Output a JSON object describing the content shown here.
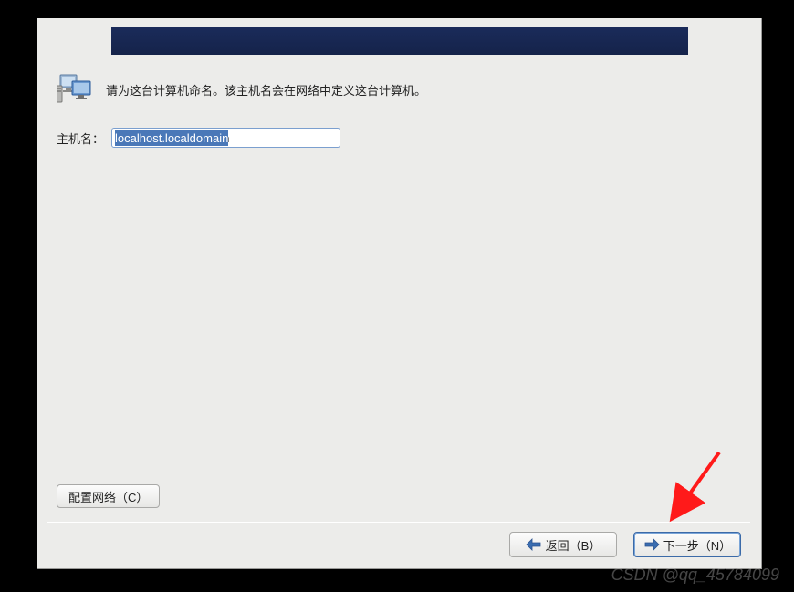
{
  "instruction_text": "请为这台计算机命名。该主机名会在网络中定义这台计算机。",
  "hostname": {
    "label": "主机名：",
    "value": "localhost.localdomain"
  },
  "buttons": {
    "configure_network": "配置网络（C）",
    "back": "返回（B）",
    "next": "下一步（N）"
  },
  "watermark": "CSDN @qq_45784099"
}
